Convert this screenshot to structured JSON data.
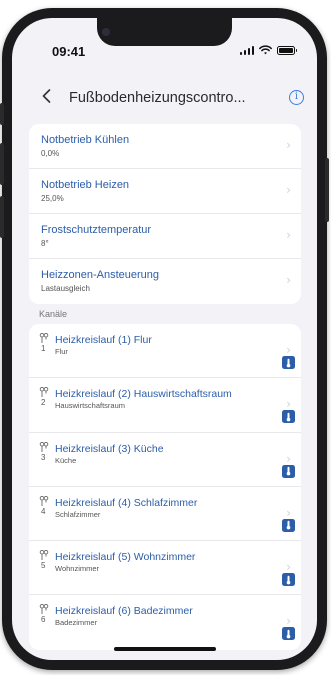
{
  "status_bar": {
    "time": "09:41",
    "icons": [
      "signal-icon",
      "wifi-icon",
      "battery-icon"
    ]
  },
  "nav": {
    "back_icon": "chevron-left-icon",
    "title": "Fußbodenheizungscontro...",
    "info_icon": "info-icon",
    "info_glyph": "i"
  },
  "settings": [
    {
      "title": "Notbetrieb Kühlen",
      "value": "0,0%"
    },
    {
      "title": "Notbetrieb Heizen",
      "value": "25,0%"
    },
    {
      "title": "Frostschutztemperatur",
      "value": "8°"
    },
    {
      "title": "Heizzonen-Ansteuerung",
      "value": "Lastausgleich"
    }
  ],
  "channels_label": "Kanäle",
  "channels": [
    {
      "number": "1",
      "title": "Heizkreislauf (1) Flur",
      "room": "Flur"
    },
    {
      "number": "2",
      "title": "Heizkreislauf (2) Hauswirtschaftsraum",
      "room": "Hauswirtschaftsraum"
    },
    {
      "number": "3",
      "title": "Heizkreislauf (3) Küche",
      "room": "Küche"
    },
    {
      "number": "4",
      "title": "Heizkreislauf (4) Schlafzimmer",
      "room": "Schlafzimmer"
    },
    {
      "number": "5",
      "title": "Heizkreislauf (5) Wohnzimmer",
      "room": "Wohnzimmer"
    },
    {
      "number": "6",
      "title": "Heizkreislauf (6) Badezimmer",
      "room": "Badezimmer"
    }
  ],
  "chevron_glyph": "›",
  "colors": {
    "accent": "#2c5ea8",
    "info": "#3c7ee0",
    "background": "#f2f2f7",
    "card": "#ffffff"
  }
}
